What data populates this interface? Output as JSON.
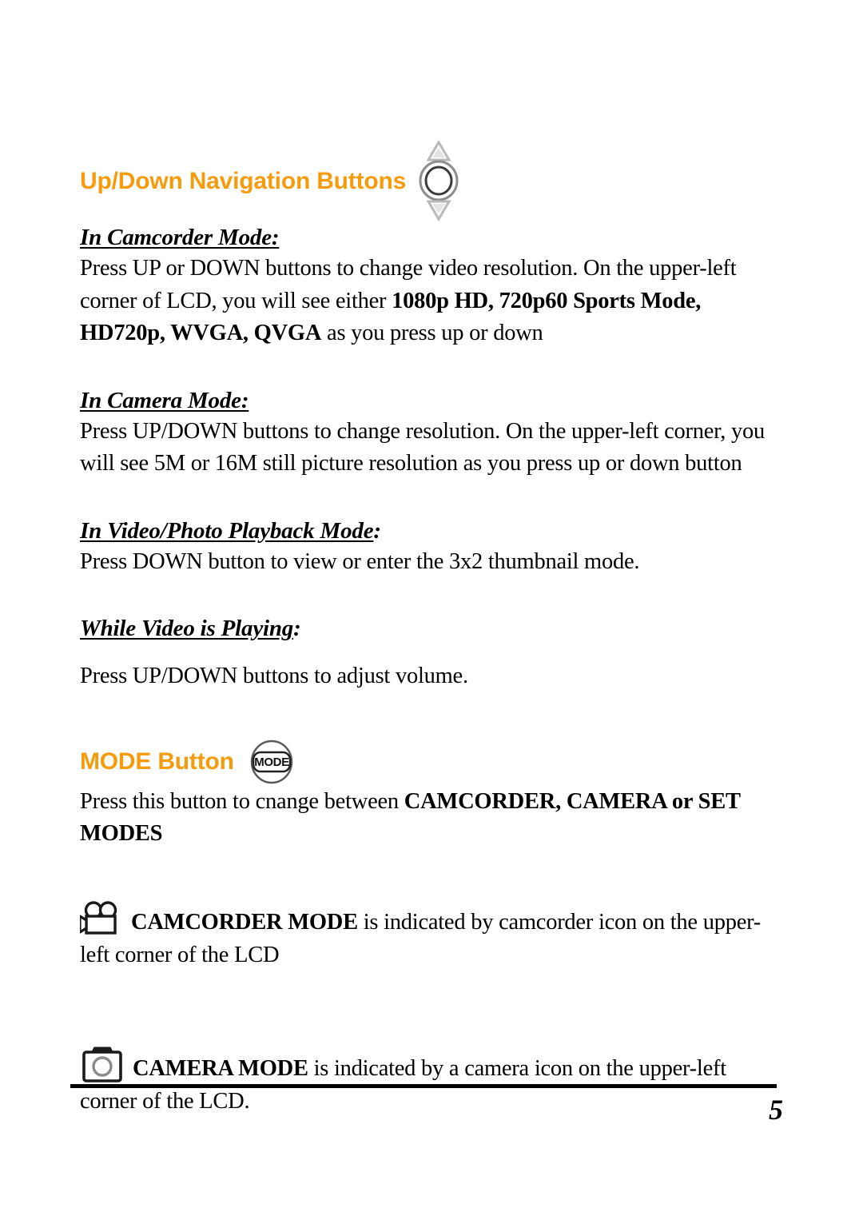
{
  "document": {
    "page_number": "5",
    "accent_color": "#F59C0E",
    "text_color": "#000000",
    "background_color": "#FFFFFF"
  },
  "sections": {
    "navigation": {
      "heading": "Up/Down Navigation Buttons",
      "icon": "up-down-navigation-button-icon",
      "camcorder_mode": {
        "label": "In Camcorder Mode:",
        "body_1": "Press UP or DOWN buttons to change video resolution. On the upper-left corner of LCD, you will see either ",
        "body_bold": "1080p HD, 720p60 Sports Mode, HD720p, WVGA, QVGA",
        "body_2": " as you press up or down"
      },
      "camera_mode": {
        "label": "In Camera Mode:",
        "body": "Press UP/DOWN buttons to change resolution. On the upper-left corner, you will see 5M or 16M still picture resolution as you press up or down button"
      },
      "playback_mode": {
        "label_underlined": "In Video/Photo Playback Mode",
        "label_suffix": ":",
        "body": "Press DOWN button to view or enter the 3x2 thumbnail mode."
      },
      "while_playing": {
        "label_underlined": "While Video is Playing",
        "label_suffix": ":",
        "body": "Press UP/DOWN buttons to adjust volume."
      }
    },
    "mode_button": {
      "heading": "MODE Button",
      "icon": "mode-button-icon",
      "icon_label": "MODE",
      "intro_1": "Press this button to cnange between ",
      "intro_bold": "CAMCORDER, CAMERA or SET MODES",
      "camcorder": {
        "icon": "camcorder-icon",
        "bold": "CAMCORDER MODE",
        "rest": " is indicated by camcorder icon on the upper-left corner of the LCD"
      },
      "camera": {
        "icon": "camera-icon",
        "bold": "CAMERA MODE",
        "rest": " is indicated by a camera icon on the upper-left corner of the LCD."
      }
    }
  }
}
